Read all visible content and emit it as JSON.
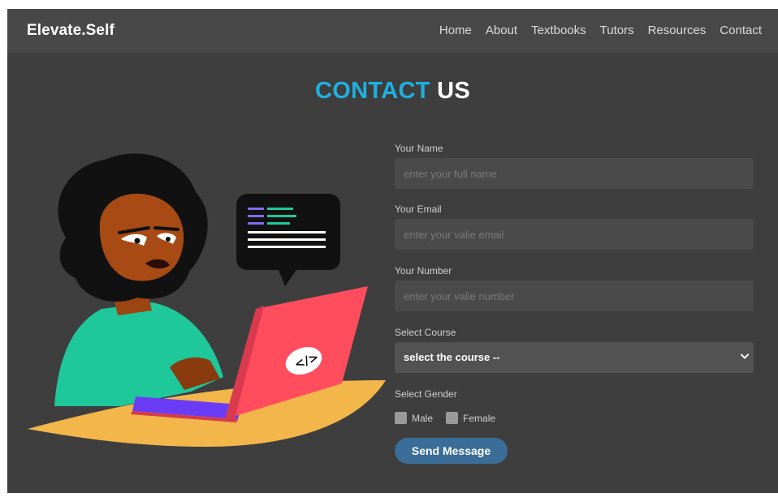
{
  "navbar": {
    "brand": "Elevate.Self",
    "links": [
      "Home",
      "About",
      "Textbooks",
      "Tutors",
      "Resources",
      "Contact"
    ]
  },
  "title": {
    "accent": "CONTACT",
    "rest": " US"
  },
  "form": {
    "name_label": "Your Name",
    "name_placeholder": "enter your full name",
    "email_label": "Your Email",
    "email_placeholder": "enter your valie email",
    "number_label": "Your Number",
    "number_placeholder": "enter your valie number",
    "course_label": "Select Course",
    "course_selected": "select the course --",
    "gender_label": "Select Gender",
    "gender_options": [
      "Male",
      "Female"
    ],
    "submit_label": "Send Message"
  },
  "colors": {
    "accent": "#1fb0e0",
    "background": "#3e3e3e",
    "navbar": "#484848",
    "button": "#3a6e98"
  }
}
